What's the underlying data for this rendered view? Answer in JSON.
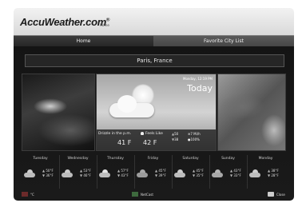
{
  "header": {
    "brand": "AccuWeather.com",
    "brand_mark": "®",
    "brand_sub": "Home"
  },
  "tabs": [
    {
      "label": "Home",
      "selected": true
    },
    {
      "label": "Favorite City List",
      "selected": false
    }
  ],
  "city": "Paris, France",
  "today": {
    "date": "Monday, 12:19 PM",
    "label": "Today",
    "condition": "Drizzle in the p.m.",
    "temp": "41 F",
    "feels_label": "Feels Like",
    "feels_temp": "42 F",
    "hi": "50",
    "lo": "38",
    "wind": "7 Mi/h",
    "humidity": "100%"
  },
  "forecast": [
    {
      "day": "Tuesday",
      "hi": "50°F",
      "lo": "36°F",
      "icon": "partly-cloudy-icon"
    },
    {
      "day": "Wednesday",
      "hi": "53°F",
      "lo": "46°F",
      "icon": "partly-cloudy-icon"
    },
    {
      "day": "Thursday",
      "hi": "57°F",
      "lo": "43°F",
      "icon": "sun-cloud-icon"
    },
    {
      "day": "Friday",
      "hi": "45°F",
      "lo": "39°F",
      "icon": "cloudy-icon"
    },
    {
      "day": "Saturday",
      "hi": "45°F",
      "lo": "35°F",
      "icon": "partly-cloudy-icon"
    },
    {
      "day": "Sunday",
      "hi": "43°F",
      "lo": "33°F",
      "icon": "cloudy-icon"
    },
    {
      "day": "Monday",
      "hi": "38°F",
      "lo": "28°F",
      "icon": "partly-cloudy-icon"
    }
  ],
  "footer": {
    "left_label": "°C",
    "center_label": "NetCast",
    "right_label": "Close"
  },
  "colors": {
    "accent_red": "#6b2a2a",
    "accent_green": "#3e6a3e"
  }
}
